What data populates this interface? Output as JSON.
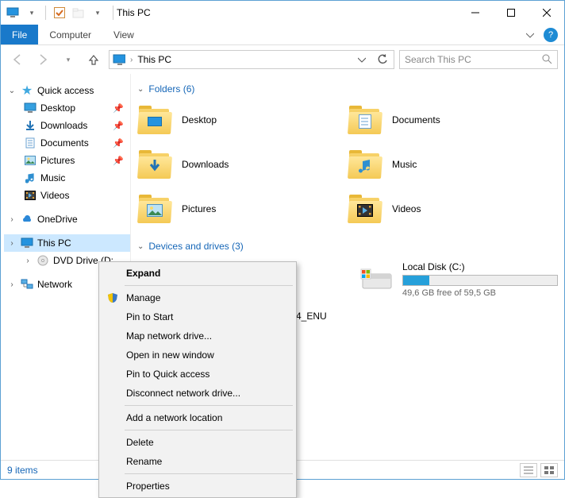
{
  "title": "This PC",
  "ribbon": {
    "file": "File",
    "computer": "Computer",
    "view": "View"
  },
  "address": {
    "path": "This PC"
  },
  "search": {
    "placeholder": "Search This PC"
  },
  "tree": {
    "quick_access": "Quick access",
    "desktop": "Desktop",
    "downloads": "Downloads",
    "documents": "Documents",
    "pictures": "Pictures",
    "music": "Music",
    "videos": "Videos",
    "onedrive": "OneDrive",
    "this_pc": "This PC",
    "dvd": "DVD Drive (D:",
    "network": "Network"
  },
  "sections": {
    "folders": "Folders (6)",
    "drives": "Devices and drives (3)"
  },
  "folders": {
    "desktop": "Desktop",
    "documents": "Documents",
    "downloads": "Downloads",
    "music": "Music",
    "pictures": "Pictures",
    "videos": "Videos"
  },
  "drives": {
    "local": {
      "name": "Local Disk (C:)",
      "free": "49,6 GB free of 59,5 GB",
      "used_pct": 17
    },
    "dvd_label_fragment": "4_ENU"
  },
  "context_menu": {
    "expand": "Expand",
    "manage": "Manage",
    "pin_start": "Pin to Start",
    "map_drive": "Map network drive...",
    "open_new": "Open in new window",
    "pin_quick": "Pin to Quick access",
    "disconnect": "Disconnect network drive...",
    "add_loc": "Add a network location",
    "delete": "Delete",
    "rename": "Rename",
    "properties": "Properties"
  },
  "status": {
    "items": "9 items"
  }
}
